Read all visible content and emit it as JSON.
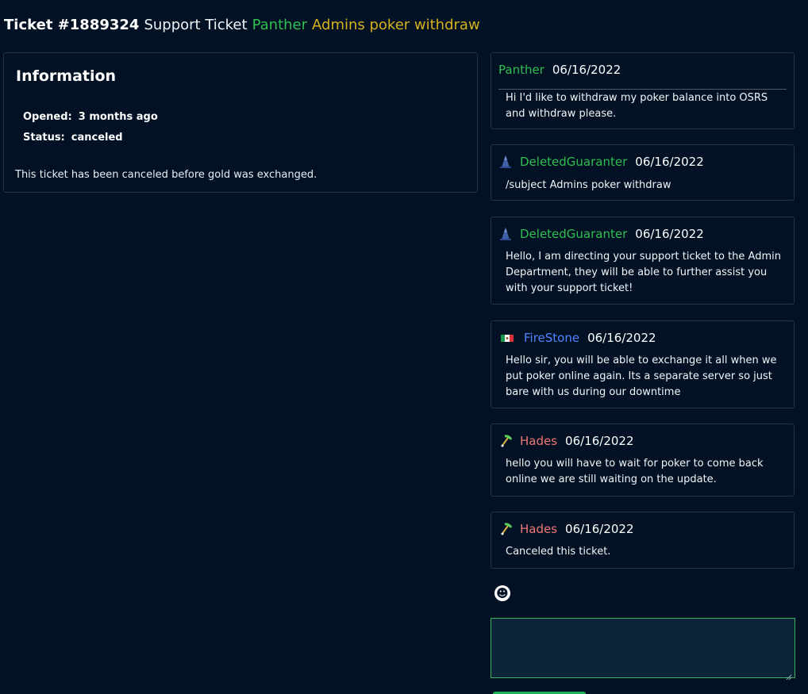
{
  "ticket": {
    "number_label": "Ticket #1889324",
    "kind": "Support Ticket",
    "user": "Panther",
    "subject": "Admins poker withdraw"
  },
  "info": {
    "heading": "Information",
    "opened_label": "Opened:",
    "opened_value": "3 months ago",
    "status_label": "Status:",
    "status_value": "canceled",
    "note": "This ticket has been canceled before gold was exchanged."
  },
  "messages": [
    {
      "author": "Panther",
      "date": "06/16/2022",
      "body": "Hi I'd like to withdraw my poker balance into OSRS and withdraw please.",
      "badge": "none",
      "author_color": "#2fbf52"
    },
    {
      "author": "DeletedGuaranter",
      "date": "06/16/2022",
      "body": "/subject Admins poker withdraw",
      "badge": "wizard-hat-icon",
      "author_color": "#2fbf52"
    },
    {
      "author": "DeletedGuaranter",
      "date": "06/16/2022",
      "body": "Hello, I am directing your support ticket to the Admin Department, they will be able to further assist you with your support ticket!",
      "badge": "wizard-hat-icon",
      "author_color": "#2fbf52"
    },
    {
      "author": "FireStone",
      "date": "06/16/2022",
      "body": "Hello sir, you will be able to exchange it all when we put poker online again. Its a separate server so just bare with us during our downtime",
      "badge": "mexico-flag-icon",
      "author_color": "#4f86ff"
    },
    {
      "author": "Hades",
      "date": "06/16/2022",
      "body": "hello you will have to wait for poker to come back online we are still waiting on the update.",
      "badge": "pickaxe-icon",
      "author_color": "#ee7777"
    },
    {
      "author": "Hades",
      "date": "06/16/2022",
      "body": "Canceled this ticket.",
      "badge": "pickaxe-icon",
      "author_color": "#ee7777"
    }
  ],
  "composer": {
    "emoji_icon": "smiley-face-icon",
    "placeholder": "",
    "value": ""
  },
  "colors": {
    "background": "#021123",
    "panel_border": "#233248",
    "green": "#2fbf52",
    "subject_yellow": "#d5b21c",
    "input_border": "#37b35e"
  }
}
